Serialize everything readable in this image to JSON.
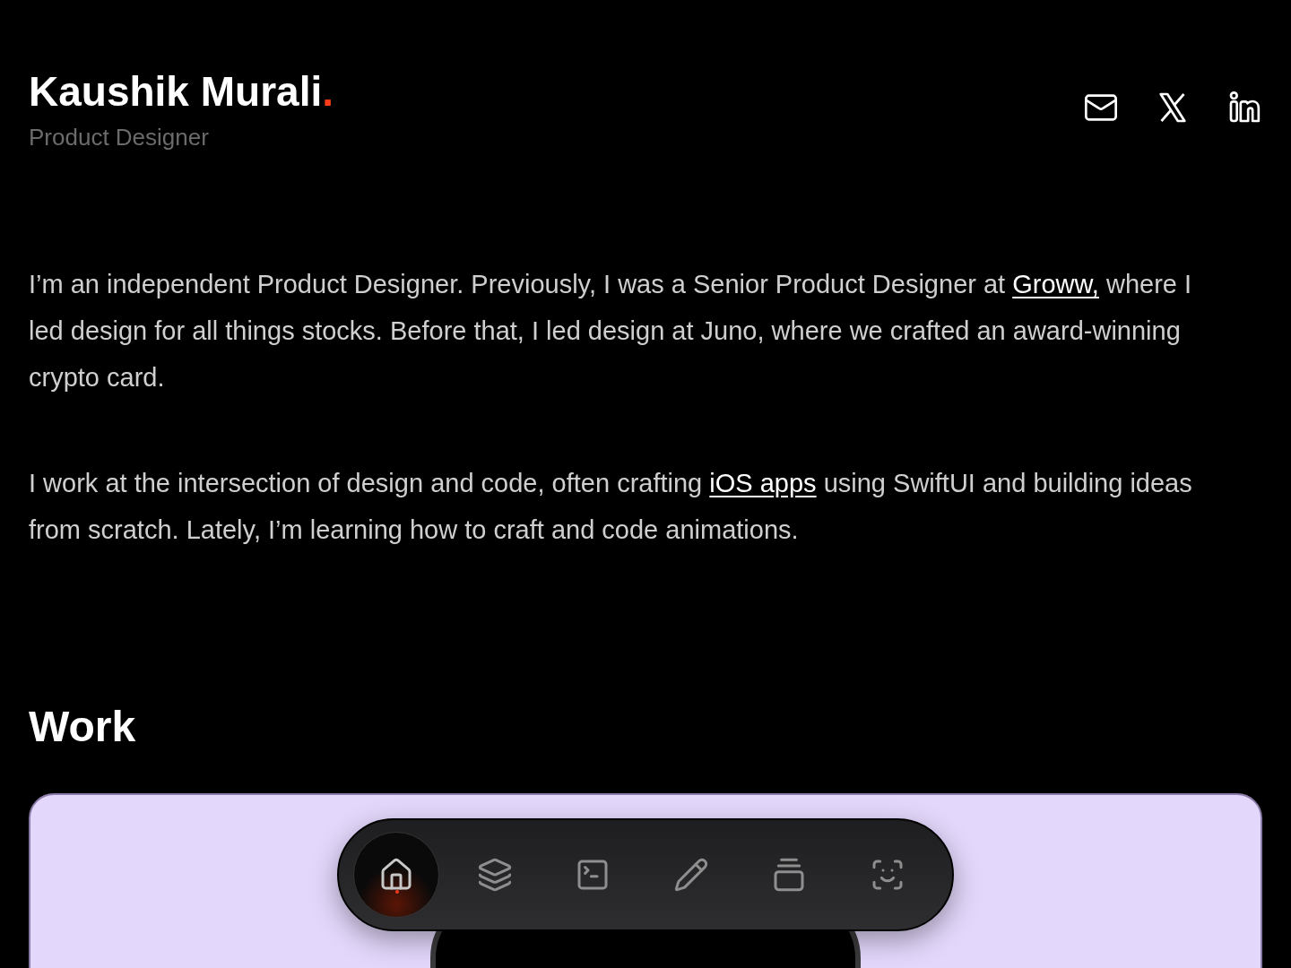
{
  "header": {
    "name": "Kaushik Murali",
    "name_mark": ".",
    "role": "Product Designer"
  },
  "social_links": [
    {
      "kind": "email"
    },
    {
      "kind": "x"
    },
    {
      "kind": "linkedin"
    }
  ],
  "intro": [
    {
      "before": "I’m an independent Product Designer. Previously, I was a Senior Product Designer at ",
      "link": "Groww,",
      "after": " where I led design for all things stocks. Before that, I led design at Juno, where we crafted an award-winning crypto card."
    },
    {
      "before": "I work at the intersection of design and code, often crafting ",
      "link": "iOS apps",
      "after": " using SwiftUI and building ideas from scratch. Lately, I’m learning how to craft and code animations."
    }
  ],
  "work": {
    "heading": "Work"
  },
  "dock": [
    {
      "selected": true
    },
    {
      "selected": false
    },
    {
      "selected": false
    },
    {
      "selected": false
    },
    {
      "selected": false
    },
    {
      "selected": false
    }
  ]
}
